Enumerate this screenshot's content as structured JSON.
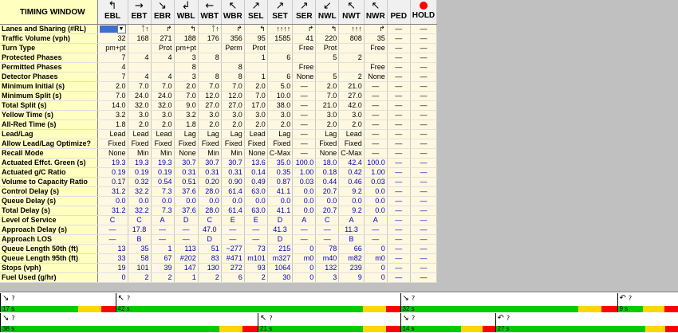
{
  "window_title": "TIMING WINDOW",
  "columns": [
    {
      "name": "EBL",
      "arrow": "↰"
    },
    {
      "name": "EBT",
      "arrow": "→"
    },
    {
      "name": "EBR",
      "arrow": "↘"
    },
    {
      "name": "WBL",
      "arrow": "↲"
    },
    {
      "name": "WBT",
      "arrow": "←"
    },
    {
      "name": "WBR",
      "arrow": "↖"
    },
    {
      "name": "SEL",
      "arrow": "↗"
    },
    {
      "name": "SET",
      "arrow": "↗"
    },
    {
      "name": "SER",
      "arrow": "↗"
    },
    {
      "name": "NWL",
      "arrow": "↙"
    },
    {
      "name": "NWT",
      "arrow": "↖"
    },
    {
      "name": "NWR",
      "arrow": "↖"
    },
    {
      "name": "PED",
      "arrow": ""
    },
    {
      "name": "HOLD",
      "arrow": ""
    }
  ],
  "rows": [
    {
      "label": "Lanes and Sharing (#RL)",
      "blue": false,
      "cells": [
        "",
        "ᛏ↑",
        "↱",
        "↰",
        "ᛏ↑",
        "↱",
        "↰",
        "↑↑↑↑",
        "↱",
        "↰",
        "↑↑↑",
        "↱",
        "—",
        "—"
      ]
    },
    {
      "label": "Traffic Volume (vph)",
      "blue": false,
      "cells": [
        "32",
        "168",
        "271",
        "188",
        "176",
        "356",
        "95",
        "1585",
        "41",
        "220",
        "808",
        "35",
        "—",
        "—"
      ]
    },
    {
      "label": "Turn Type",
      "blue": false,
      "cells": [
        "pm+pt",
        "",
        "Prot",
        "pm+pt",
        "",
        "Perm",
        "Prot",
        "",
        "Free",
        "Prot",
        "",
        "Free",
        "—",
        "—"
      ]
    },
    {
      "label": "Protected Phases",
      "blue": false,
      "cells": [
        "7",
        "4",
        "4",
        "3",
        "8",
        "",
        "1",
        "6",
        "",
        "5",
        "2",
        "",
        "—",
        "—"
      ]
    },
    {
      "label": "Permitted Phases",
      "blue": false,
      "cells": [
        "4",
        "",
        "",
        "8",
        "",
        "8",
        "",
        "",
        "Free",
        "",
        "",
        "Free",
        "—",
        "—"
      ]
    },
    {
      "label": "Detector Phases",
      "blue": false,
      "cells": [
        "7",
        "4",
        "4",
        "3",
        "8",
        "8",
        "1",
        "6",
        "None",
        "5",
        "2",
        "None",
        "—",
        "—"
      ]
    },
    {
      "label": "Minimum Initial (s)",
      "blue": false,
      "cells": [
        "2.0",
        "7.0",
        "7.0",
        "2.0",
        "7.0",
        "7.0",
        "2.0",
        "5.0",
        "—",
        "2.0",
        "21.0",
        "—",
        "—",
        "—"
      ]
    },
    {
      "label": "Minimum Split (s)",
      "blue": false,
      "cells": [
        "7.0",
        "24.0",
        "24.0",
        "7.0",
        "12.0",
        "12.0",
        "7.0",
        "10.0",
        "—",
        "7.0",
        "27.0",
        "—",
        "—",
        "—"
      ]
    },
    {
      "label": "Total Split (s)",
      "blue": false,
      "cells": [
        "14.0",
        "32.0",
        "32.0",
        "9.0",
        "27.0",
        "27.0",
        "17.0",
        "38.0",
        "—",
        "21.0",
        "42.0",
        "—",
        "—",
        "—"
      ]
    },
    {
      "label": "Yellow Time (s)",
      "blue": false,
      "cells": [
        "3.2",
        "3.0",
        "3.0",
        "3.2",
        "3.0",
        "3.0",
        "3.0",
        "3.0",
        "—",
        "3.0",
        "3.0",
        "—",
        "—",
        "—"
      ]
    },
    {
      "label": "All-Red Time (s)",
      "blue": false,
      "cells": [
        "1.8",
        "2.0",
        "2.0",
        "1.8",
        "2.0",
        "2.0",
        "2.0",
        "2.0",
        "—",
        "2.0",
        "2.0",
        "—",
        "—",
        "—"
      ]
    },
    {
      "label": "Lead/Lag",
      "blue": false,
      "cells": [
        "Lead",
        "Lead",
        "Lead",
        "Lag",
        "Lag",
        "Lag",
        "Lead",
        "Lag",
        "—",
        "Lag",
        "Lead",
        "—",
        "—",
        "—"
      ]
    },
    {
      "label": "Allow Lead/Lag Optimize?",
      "blue": false,
      "cells": [
        "Fixed",
        "Fixed",
        "Fixed",
        "Fixed",
        "Fixed",
        "Fixed",
        "Fixed",
        "Fixed",
        "—",
        "Fixed",
        "Fixed",
        "—",
        "—",
        "—"
      ]
    },
    {
      "label": "Recall Mode",
      "blue": false,
      "cells": [
        "None",
        "Min",
        "Min",
        "None",
        "Min",
        "Min",
        "None",
        "C-Max",
        "—",
        "None",
        "C-Max",
        "—",
        "—",
        "—"
      ]
    },
    {
      "label": "Actuated Effct. Green (s)",
      "blue": true,
      "cells": [
        "19.3",
        "19.3",
        "19.3",
        "30.7",
        "30.7",
        "30.7",
        "13.6",
        "35.0",
        "100.0",
        "18.0",
        "42.4",
        "100.0",
        "—",
        "—"
      ]
    },
    {
      "label": "Actuated g/C Ratio",
      "blue": true,
      "cells": [
        "0.19",
        "0.19",
        "0.19",
        "0.31",
        "0.31",
        "0.31",
        "0.14",
        "0.35",
        "1.00",
        "0.18",
        "0.42",
        "1.00",
        "—",
        "—"
      ]
    },
    {
      "label": "Volume to Capacity Ratio",
      "blue": true,
      "cells": [
        "0.17",
        "0.32",
        "0.54",
        "0.51",
        "0.20",
        "0.90",
        "0.49",
        "0.87",
        "0.03",
        "0.44",
        "0.46",
        "0.03",
        "—",
        "—"
      ]
    },
    {
      "label": "Control Delay (s)",
      "blue": true,
      "cells": [
        "31.2",
        "32.2",
        "7.3",
        "37.6",
        "28.0",
        "61.4",
        "63.0",
        "41.1",
        "0.0",
        "20.7",
        "9.2",
        "0.0",
        "—",
        "—"
      ]
    },
    {
      "label": "Queue Delay (s)",
      "blue": true,
      "cells": [
        "0.0",
        "0.0",
        "0.0",
        "0.0",
        "0.0",
        "0.0",
        "0.0",
        "0.0",
        "0.0",
        "0.0",
        "0.0",
        "0.0",
        "—",
        "—"
      ]
    },
    {
      "label": "Total Delay (s)",
      "blue": true,
      "cells": [
        "31.2",
        "32.2",
        "7.3",
        "37.6",
        "28.0",
        "61.4",
        "63.0",
        "41.1",
        "0.0",
        "20.7",
        "9.2",
        "0.0",
        "—",
        "—"
      ]
    },
    {
      "label": "Level of Service",
      "blue": true,
      "center": true,
      "cells": [
        "C",
        "C",
        "A",
        "D",
        "C",
        "E",
        "E",
        "D",
        "A",
        "C",
        "A",
        "A",
        "—",
        "—"
      ]
    },
    {
      "label": "Approach Delay (s)",
      "blue": true,
      "center": true,
      "cells": [
        "—",
        "17.8",
        "—",
        "—",
        "47.0",
        "—",
        "—",
        "41.3",
        "—",
        "—",
        "11.3",
        "—",
        "—",
        "—"
      ]
    },
    {
      "label": "Approach LOS",
      "blue": true,
      "center": true,
      "cells": [
        "—",
        "B",
        "—",
        "—",
        "D",
        "—",
        "—",
        "D",
        "—",
        "—",
        "B",
        "—",
        "—",
        "—"
      ]
    },
    {
      "label": "Queue Length 50th (ft)",
      "blue": true,
      "cells": [
        "13",
        "35",
        "1",
        "113",
        "51",
        "~277",
        "73",
        "215",
        "0",
        "78",
        "66",
        "0",
        "—",
        "—"
      ]
    },
    {
      "label": "Queue Length 95th (ft)",
      "blue": true,
      "cells": [
        "33",
        "58",
        "67",
        "#202",
        "83",
        "#471",
        "m101",
        "m327",
        "m0",
        "m40",
        "m82",
        "m0",
        "—",
        "—"
      ]
    },
    {
      "label": "Stops (vph)",
      "blue": true,
      "cells": [
        "19",
        "101",
        "39",
        "147",
        "130",
        "272",
        "93",
        "1064",
        "0",
        "132",
        "239",
        "0",
        "—",
        "—"
      ]
    },
    {
      "label": "Fuel Used (g/hr)",
      "blue": true,
      "cells": [
        "0",
        "2",
        "2",
        "1",
        "2",
        "6",
        "2",
        "30",
        "0",
        "3",
        "9",
        "0",
        "—",
        "—"
      ]
    }
  ],
  "timing": {
    "row1": [
      {
        "icon": "↘",
        "label": "?",
        "time": "17 s",
        "start": 0.0,
        "dur": 0.17,
        "yellow": 0.2,
        "red": 0.12
      },
      {
        "icon": "↖",
        "label": "?",
        "time": "42 s",
        "start": 0.17,
        "dur": 0.42,
        "yellow": 0.08,
        "red": 0.05
      },
      {
        "icon": "↘",
        "label": "?",
        "time": "32 s",
        "start": 0.59,
        "dur": 0.32,
        "yellow": 0.11,
        "red": 0.07
      },
      {
        "icon": "↶",
        "label": "?",
        "time": "9 s",
        "start": 0.91,
        "dur": 0.09,
        "yellow": 0.36,
        "red": 0.22
      }
    ],
    "row2": [
      {
        "icon": "↘",
        "label": "?",
        "time": "38 s",
        "start": 0.0,
        "dur": 0.38,
        "yellow": 0.09,
        "red": 0.06
      },
      {
        "icon": "↖",
        "label": "?",
        "time": "21 s",
        "start": 0.38,
        "dur": 0.21,
        "yellow": 0.16,
        "red": 0.1
      },
      {
        "icon": "↘",
        "label": "?",
        "time": "14 s",
        "start": 0.59,
        "dur": 0.14,
        "yellow": 0.23,
        "red": 0.13
      },
      {
        "icon": "↶",
        "label": "?",
        "time": "27 s",
        "start": 0.73,
        "dur": 0.27,
        "yellow": 0.11,
        "red": 0.07
      }
    ]
  },
  "colors": {
    "green": "#00cc00",
    "yellow": "#ffd700",
    "red": "#ff0000",
    "blue_text": "#0000c0",
    "label_bg": "#ffffc0"
  }
}
